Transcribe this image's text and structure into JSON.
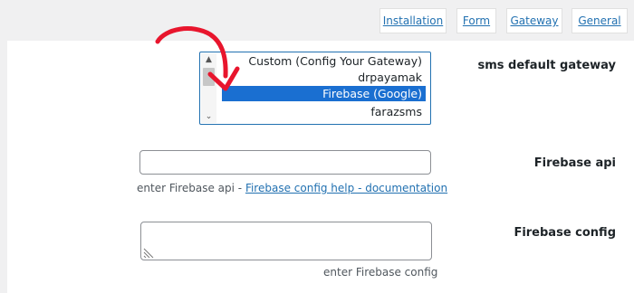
{
  "tabs": [
    {
      "label": "Installation"
    },
    {
      "label": "Form"
    },
    {
      "label": "Gateway"
    },
    {
      "label": "General"
    }
  ],
  "gateway": {
    "label": "sms default gateway",
    "options": [
      "Custom (Config Your Gateway)",
      "drpayamak",
      "Firebase (Google)",
      "farazsms"
    ],
    "selected": "Firebase (Google)"
  },
  "firebase_api": {
    "label": "Firebase api",
    "value": "",
    "description_prefix": "enter Firebase api -",
    "help_link": "Firebase config help - documentation"
  },
  "firebase_config": {
    "label": "Firebase config",
    "value": "",
    "description": "enter Firebase config"
  },
  "annotation": {
    "color": "#e8152d",
    "icon": "red-arrow-annotation"
  },
  "colors": {
    "accent": "#2271b1",
    "selected_option": "#1a6fd1",
    "background": "#f0f0f1"
  }
}
